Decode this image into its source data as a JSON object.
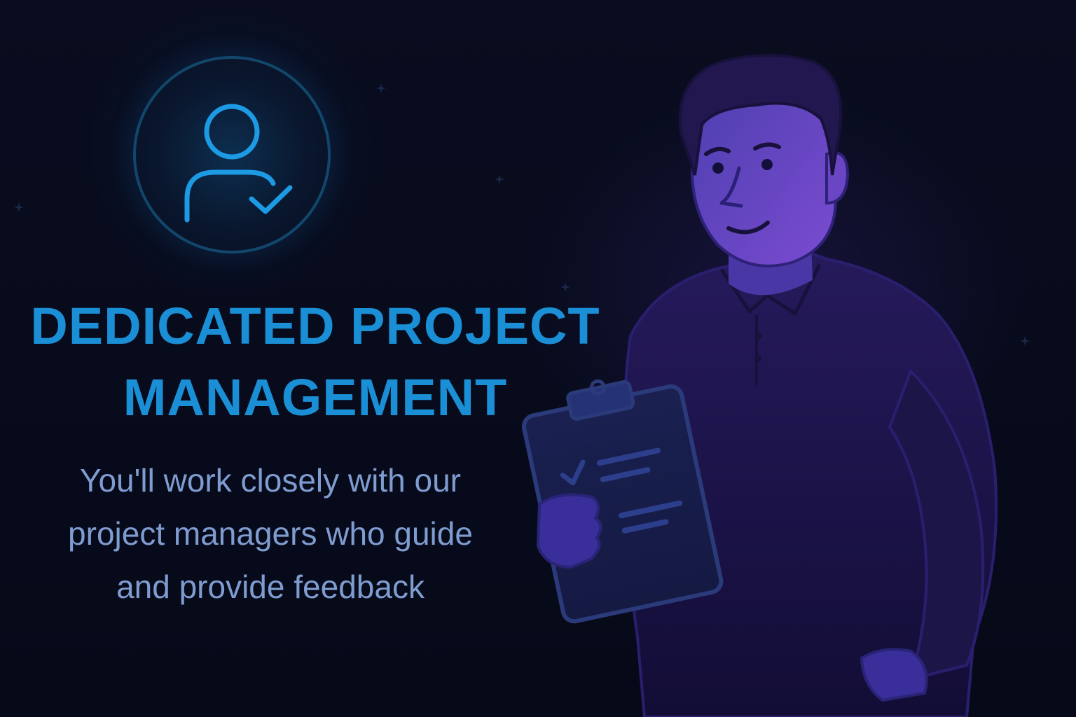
{
  "headline": {
    "line1": "DEDICATED PROJECT",
    "line2": "MANAGEMENT"
  },
  "subtitle": {
    "line1": "You'll work closely with our",
    "line2": "project managers who guide",
    "line3": "and provide feedback"
  },
  "icons": {
    "badge": "user-check-icon",
    "illustration": "person-with-clipboard-illustration"
  },
  "colors": {
    "background": "#070b1a",
    "accent": "#1a8fd6",
    "subtitle": "#7f9cd0",
    "figure": "#5a3fb8"
  }
}
